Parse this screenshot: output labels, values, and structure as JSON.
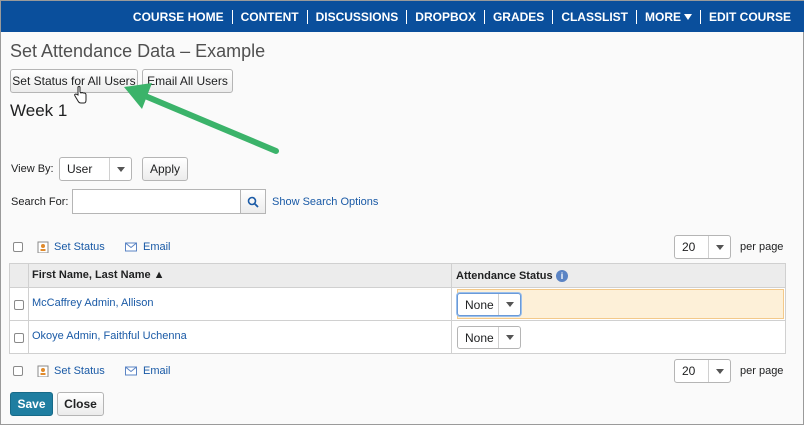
{
  "nav": {
    "items": [
      "COURSE HOME",
      "CONTENT",
      "DISCUSSIONS",
      "DROPBOX",
      "GRADES",
      "CLASSLIST"
    ],
    "more": "MORE",
    "edit_course": "EDIT COURSE"
  },
  "page": {
    "title": "Set Attendance Data – Example",
    "set_status_all_label": "Set Status for All Users",
    "email_all_label": "Email All Users",
    "week_heading": "Week 1"
  },
  "filters": {
    "view_by_label": "View By:",
    "view_by_value": "User",
    "apply_label": "Apply",
    "search_label": "Search For:",
    "search_value": "",
    "show_search_options": "Show Search Options"
  },
  "toolbar": {
    "set_status_label": "Set Status",
    "email_label": "Email",
    "per_page_value": "20",
    "per_page_label": "per page"
  },
  "table": {
    "col_name": "First Name, Last Name ▲",
    "col_status": "Attendance Status",
    "rows": [
      {
        "name": "McCaffrey Admin, Allison",
        "status": "None"
      },
      {
        "name": "Okoye Admin, Faithful Uchenna",
        "status": "None"
      }
    ]
  },
  "actions": {
    "save_label": "Save",
    "close_label": "Close"
  },
  "colors": {
    "nav_bg": "#0a4f9c",
    "link": "#1a5aa6",
    "save_bg": "#1f7ea1",
    "arrow": "#3bb36a",
    "highlight": "#fdf0d8"
  },
  "icons": [
    "chevron-down-icon",
    "search-icon",
    "set-status-icon",
    "email-icon",
    "info-icon",
    "hand-cursor-icon",
    "sort-ascending-icon"
  ]
}
